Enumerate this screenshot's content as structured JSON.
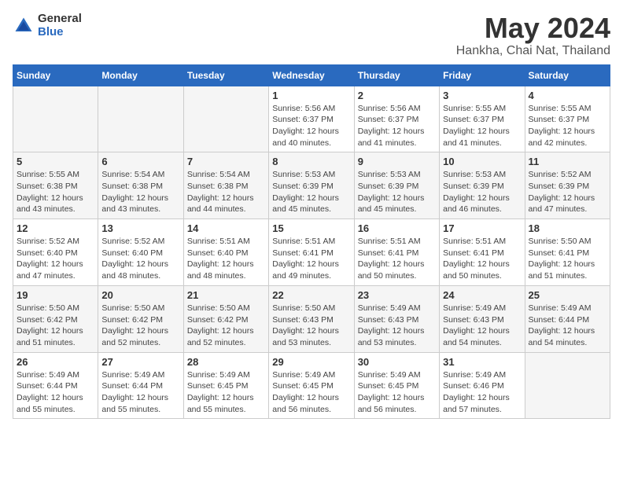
{
  "header": {
    "logo_general": "General",
    "logo_blue": "Blue",
    "month_title": "May 2024",
    "location": "Hankha, Chai Nat, Thailand"
  },
  "weekdays": [
    "Sunday",
    "Monday",
    "Tuesday",
    "Wednesday",
    "Thursday",
    "Friday",
    "Saturday"
  ],
  "weeks": [
    [
      {
        "day": "",
        "empty": true
      },
      {
        "day": "",
        "empty": true
      },
      {
        "day": "",
        "empty": true
      },
      {
        "day": "1",
        "sunrise": "5:56 AM",
        "sunset": "6:37 PM",
        "daylight": "12 hours and 40 minutes."
      },
      {
        "day": "2",
        "sunrise": "5:56 AM",
        "sunset": "6:37 PM",
        "daylight": "12 hours and 41 minutes."
      },
      {
        "day": "3",
        "sunrise": "5:55 AM",
        "sunset": "6:37 PM",
        "daylight": "12 hours and 41 minutes."
      },
      {
        "day": "4",
        "sunrise": "5:55 AM",
        "sunset": "6:37 PM",
        "daylight": "12 hours and 42 minutes."
      }
    ],
    [
      {
        "day": "5",
        "sunrise": "5:55 AM",
        "sunset": "6:38 PM",
        "daylight": "12 hours and 43 minutes."
      },
      {
        "day": "6",
        "sunrise": "5:54 AM",
        "sunset": "6:38 PM",
        "daylight": "12 hours and 43 minutes."
      },
      {
        "day": "7",
        "sunrise": "5:54 AM",
        "sunset": "6:38 PM",
        "daylight": "12 hours and 44 minutes."
      },
      {
        "day": "8",
        "sunrise": "5:53 AM",
        "sunset": "6:39 PM",
        "daylight": "12 hours and 45 minutes."
      },
      {
        "day": "9",
        "sunrise": "5:53 AM",
        "sunset": "6:39 PM",
        "daylight": "12 hours and 45 minutes."
      },
      {
        "day": "10",
        "sunrise": "5:53 AM",
        "sunset": "6:39 PM",
        "daylight": "12 hours and 46 minutes."
      },
      {
        "day": "11",
        "sunrise": "5:52 AM",
        "sunset": "6:39 PM",
        "daylight": "12 hours and 47 minutes."
      }
    ],
    [
      {
        "day": "12",
        "sunrise": "5:52 AM",
        "sunset": "6:40 PM",
        "daylight": "12 hours and 47 minutes."
      },
      {
        "day": "13",
        "sunrise": "5:52 AM",
        "sunset": "6:40 PM",
        "daylight": "12 hours and 48 minutes."
      },
      {
        "day": "14",
        "sunrise": "5:51 AM",
        "sunset": "6:40 PM",
        "daylight": "12 hours and 48 minutes."
      },
      {
        "day": "15",
        "sunrise": "5:51 AM",
        "sunset": "6:41 PM",
        "daylight": "12 hours and 49 minutes."
      },
      {
        "day": "16",
        "sunrise": "5:51 AM",
        "sunset": "6:41 PM",
        "daylight": "12 hours and 50 minutes."
      },
      {
        "day": "17",
        "sunrise": "5:51 AM",
        "sunset": "6:41 PM",
        "daylight": "12 hours and 50 minutes."
      },
      {
        "day": "18",
        "sunrise": "5:50 AM",
        "sunset": "6:41 PM",
        "daylight": "12 hours and 51 minutes."
      }
    ],
    [
      {
        "day": "19",
        "sunrise": "5:50 AM",
        "sunset": "6:42 PM",
        "daylight": "12 hours and 51 minutes."
      },
      {
        "day": "20",
        "sunrise": "5:50 AM",
        "sunset": "6:42 PM",
        "daylight": "12 hours and 52 minutes."
      },
      {
        "day": "21",
        "sunrise": "5:50 AM",
        "sunset": "6:42 PM",
        "daylight": "12 hours and 52 minutes."
      },
      {
        "day": "22",
        "sunrise": "5:50 AM",
        "sunset": "6:43 PM",
        "daylight": "12 hours and 53 minutes."
      },
      {
        "day": "23",
        "sunrise": "5:49 AM",
        "sunset": "6:43 PM",
        "daylight": "12 hours and 53 minutes."
      },
      {
        "day": "24",
        "sunrise": "5:49 AM",
        "sunset": "6:43 PM",
        "daylight": "12 hours and 54 minutes."
      },
      {
        "day": "25",
        "sunrise": "5:49 AM",
        "sunset": "6:44 PM",
        "daylight": "12 hours and 54 minutes."
      }
    ],
    [
      {
        "day": "26",
        "sunrise": "5:49 AM",
        "sunset": "6:44 PM",
        "daylight": "12 hours and 55 minutes."
      },
      {
        "day": "27",
        "sunrise": "5:49 AM",
        "sunset": "6:44 PM",
        "daylight": "12 hours and 55 minutes."
      },
      {
        "day": "28",
        "sunrise": "5:49 AM",
        "sunset": "6:45 PM",
        "daylight": "12 hours and 55 minutes."
      },
      {
        "day": "29",
        "sunrise": "5:49 AM",
        "sunset": "6:45 PM",
        "daylight": "12 hours and 56 minutes."
      },
      {
        "day": "30",
        "sunrise": "5:49 AM",
        "sunset": "6:45 PM",
        "daylight": "12 hours and 56 minutes."
      },
      {
        "day": "31",
        "sunrise": "5:49 AM",
        "sunset": "6:46 PM",
        "daylight": "12 hours and 57 minutes."
      },
      {
        "day": "",
        "empty": true
      }
    ]
  ]
}
